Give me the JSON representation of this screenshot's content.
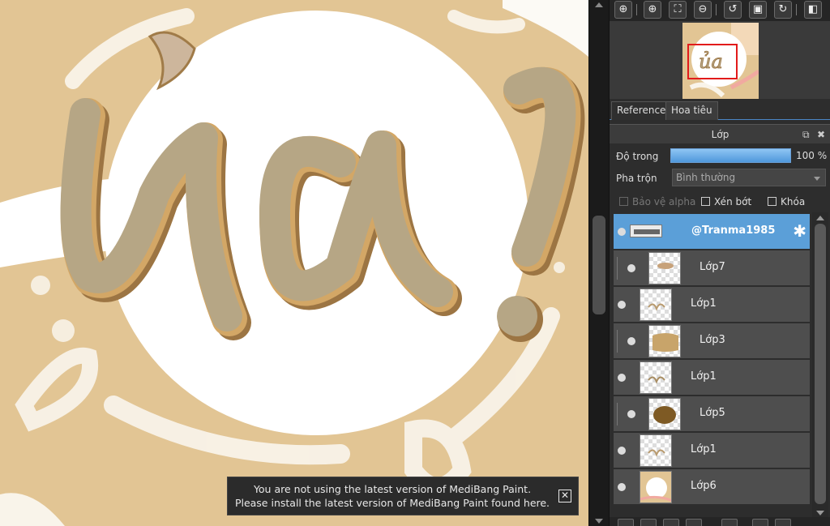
{
  "notification": {
    "line1": "You are not using the latest version of MediBang Paint.",
    "line2": "Please install the latest version of MediBang Paint found here.",
    "close_glyph": "✕"
  },
  "canvas": {
    "lettering": "ủa?",
    "colors": {
      "background": "#e2c594",
      "circle": "#ffffff",
      "letter_fill": "#b8a582",
      "letter_shadow": "#9c7543",
      "highlight": "#cfa77a"
    }
  },
  "navigator_toolbar": {
    "icons": [
      "zoom-in-fit-icon",
      "zoom-in-icon",
      "fit-screen-icon",
      "zoom-out-icon",
      "rotate-left-icon",
      "actual-size-icon",
      "rotate-right-icon",
      "flip-icon"
    ]
  },
  "tabs": [
    {
      "label": "Reference"
    },
    {
      "label": "Hoa tiêu"
    }
  ],
  "layer_panel": {
    "title": "Lớp",
    "opacity_label": "Độ trong",
    "opacity_value": "100 %",
    "opacity_percent": 100,
    "blend_label": "Pha trộn",
    "blend_value": "Bình thường",
    "protect_alpha_label": "Bảo vệ alpha",
    "clip_label": "Xén bớt",
    "lock_label": "Khóa",
    "layers": [
      {
        "name": "@Tranma1985",
        "selected": true,
        "clipped": false
      },
      {
        "name": "Lớp7",
        "selected": false,
        "clipped": true
      },
      {
        "name": "Lớp1",
        "selected": false,
        "clipped": false
      },
      {
        "name": "Lớp3",
        "selected": false,
        "clipped": true
      },
      {
        "name": "Lớp1",
        "selected": false,
        "clipped": false
      },
      {
        "name": "Lớp5",
        "selected": false,
        "clipped": true
      },
      {
        "name": "Lớp1",
        "selected": false,
        "clipped": false
      },
      {
        "name": "Lớp6",
        "selected": false,
        "clipped": false
      }
    ]
  },
  "colors": {
    "accent": "#5b9fd8",
    "panel": "#2d2d2d",
    "row": "#4e4e4e"
  }
}
